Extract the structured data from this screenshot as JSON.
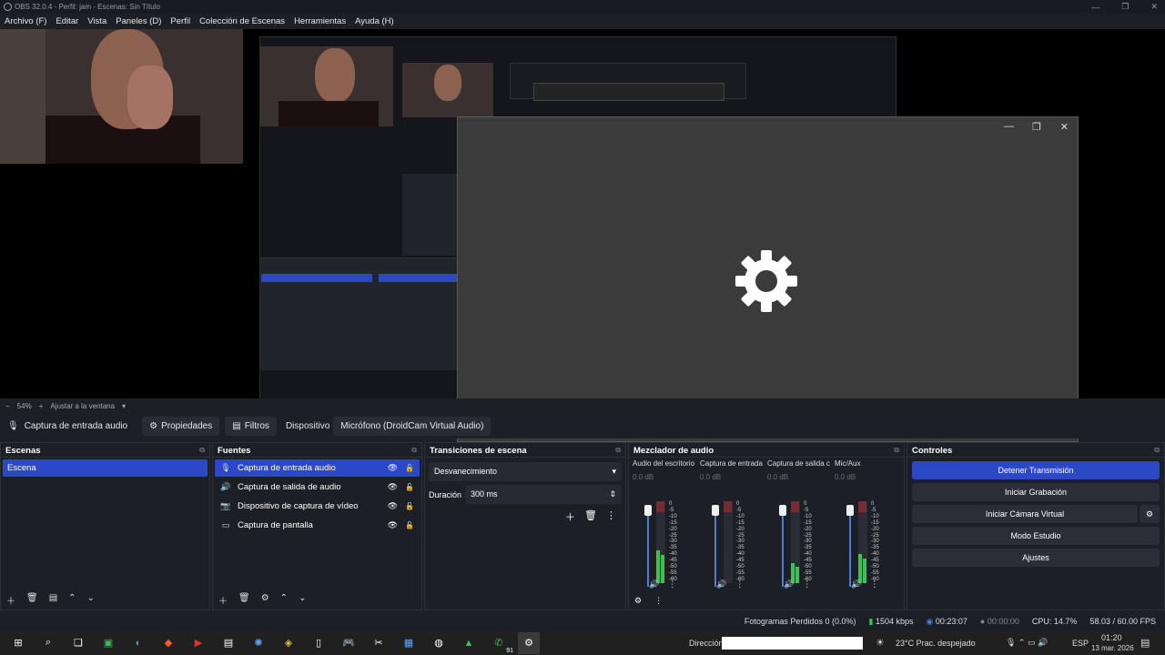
{
  "window": {
    "title": "OBS 32.0.4 - Perfil: jam - Escenas: Sin Título",
    "minimize": "—",
    "maximize": "❐",
    "close": "✕"
  },
  "menu": [
    "Archivo (F)",
    "Editar",
    "Vista",
    "Paneles (D)",
    "Perfil",
    "Colección de Escenas",
    "Herramientas",
    "Ayuda (H)"
  ],
  "zoom": {
    "level": "54%",
    "fit_label": "Ajustar a la ventana"
  },
  "context": {
    "source_name": "Captura de entrada audio",
    "props": "Propiedades",
    "filters": "Filtros",
    "device_label": "Dispositivo",
    "device_value": "Micrófono (DroidCam Virtual Audio)"
  },
  "scenes": {
    "title": "Escenas",
    "items": [
      "Escena"
    ]
  },
  "sources": {
    "title": "Fuentes",
    "items": [
      {
        "label": "Captura de entrada audio",
        "icon": "mic-icon"
      },
      {
        "label": "Captura de salida de audio",
        "icon": "speaker-icon"
      },
      {
        "label": "Dispositivo de captura de vídeo",
        "icon": "camera-icon"
      },
      {
        "label": "Captura de pantalla",
        "icon": "monitor-icon"
      }
    ]
  },
  "transitions": {
    "title": "Transiciones de escena",
    "selected": "Desvanecimiento",
    "duration_label": "Duración",
    "duration_value": "300 ms"
  },
  "mixer": {
    "title": "Mezclador de audio",
    "channels": [
      {
        "name": "Audio del escritorio",
        "db": "0.0 dB"
      },
      {
        "name": "Captura de entrada",
        "db": "0.0 dB"
      },
      {
        "name": "Captura de salida c",
        "db": "0.0 dB"
      },
      {
        "name": "Mic/Aux",
        "db": "0.0 dB"
      }
    ],
    "scale": [
      "0",
      "-5",
      "-10",
      "-15",
      "-20",
      "-25",
      "-30",
      "-35",
      "-40",
      "-45",
      "-50",
      "-55",
      "-60"
    ]
  },
  "controls": {
    "title": "Controles",
    "stop_stream": "Detener Transmisión",
    "start_record": "Iniciar Grabación",
    "start_vcam": "Iniciar Cámara Virtual",
    "studio_mode": "Modo Estudio",
    "settings": "Ajustes"
  },
  "status": {
    "dropped": "Fotogramas Perdidos 0 (0.0%)",
    "bitrate": "1504 kbps",
    "live_time": "00:23:07",
    "rec_time": "00:00:00",
    "cpu": "CPU: 14.7%",
    "fps": "58.03 / 60.00 FPS"
  },
  "taskbar": {
    "address_label": "Dirección",
    "weather": "23°C  Prac. despejado",
    "lang": "ESP",
    "time": "01:20",
    "date": "13 mar. 2026",
    "badge_whatsapp": "91",
    "notif_count": "5"
  },
  "colors": {
    "accent": "#2d48c6",
    "bg": "#1d1f26",
    "panel_border": "#2e3039"
  }
}
